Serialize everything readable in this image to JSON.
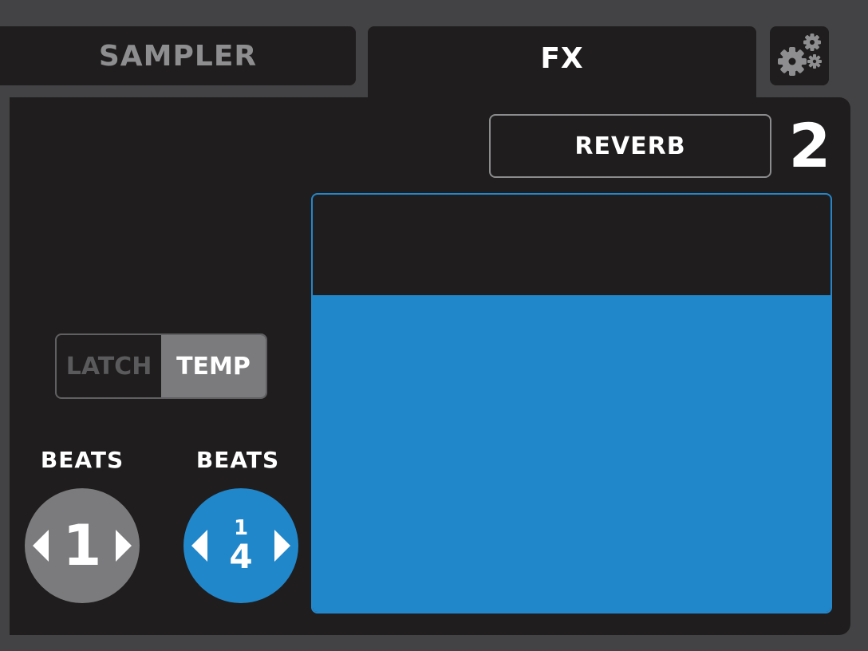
{
  "tabs": {
    "sampler_label": "SAMPLER",
    "fx_label": "FX",
    "settings_icon": "gears-icon"
  },
  "fx": {
    "effect_name": "REVERB",
    "unit_number": "2",
    "pad_level_percent": 76
  },
  "mode_toggle": {
    "latch_label": "LATCH",
    "temp_label": "TEMP",
    "selected": "TEMP"
  },
  "beats": [
    {
      "label": "BEATS",
      "value": "1"
    },
    {
      "label": "BEATS",
      "numerator": "1",
      "denominator": "4"
    }
  ],
  "colors": {
    "accent": "#2187cb",
    "panel": "#1f1d1d",
    "inactive": "#7b7b7d"
  }
}
